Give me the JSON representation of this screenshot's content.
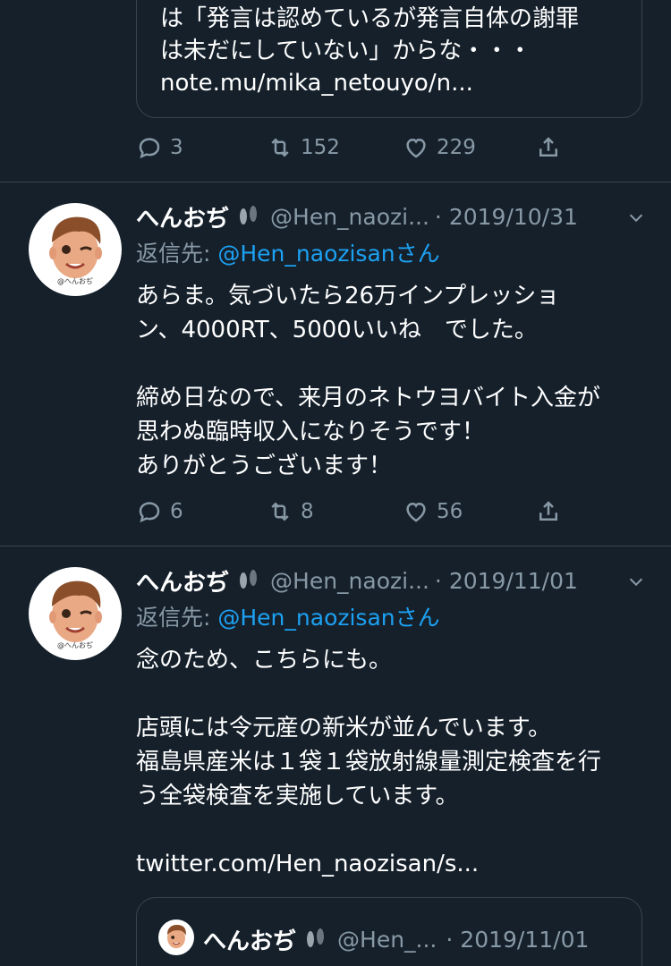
{
  "top_tweet": {
    "quote_lines": [
      "は「発言は認めているが発言自体の謝罪",
      "は未だにしていない」からな・・・",
      "note.mu/mika_netouyo/n..."
    ],
    "actions": {
      "reply_count": "3",
      "retweet_count": "152",
      "like_count": "229"
    }
  },
  "tweets": [
    {
      "name": "へんおぢ",
      "handle": "@Hen_naozi...",
      "date": "· 2019/10/31",
      "reply_prefix": "返信先: ",
      "reply_to": "@Hen_naozisan",
      "reply_suffix": "さん",
      "avatar_caption": "@へんおぢ",
      "lines": [
        "あらま。気づいたら26万インプレッショ",
        "ン、4000RT、5000いいね　でした。",
        "",
        "締め日なので、来月のネトウヨバイト入金が",
        "思わぬ臨時収入になりそうです！",
        "ありがとうございます！"
      ],
      "actions": {
        "reply_count": "6",
        "retweet_count": "8",
        "like_count": "56"
      }
    },
    {
      "name": "へんおぢ",
      "handle": "@Hen_naozi...",
      "date": "· 2019/11/01",
      "reply_prefix": "返信先: ",
      "reply_to": "@Hen_naozisan",
      "reply_suffix": "さん",
      "avatar_caption": "@へんおぢ",
      "lines": [
        "念のため、こちらにも。",
        "",
        "店頭には令元産の新米が並んでいます。",
        "福島県産米は１袋１袋放射線量測定検査を行",
        "う全袋検査を実施しています。",
        ""
      ],
      "link": "twitter.com/Hen_naozisan/s...",
      "quoted": {
        "name": "へんおぢ",
        "handle": "@Hen_...",
        "date": "· 2019/11/01"
      }
    }
  ],
  "colors": {
    "background": "#15202b",
    "text": "#ffffff",
    "secondary": "#8899a6",
    "link": "#1da1f2",
    "border": "#38444d"
  }
}
